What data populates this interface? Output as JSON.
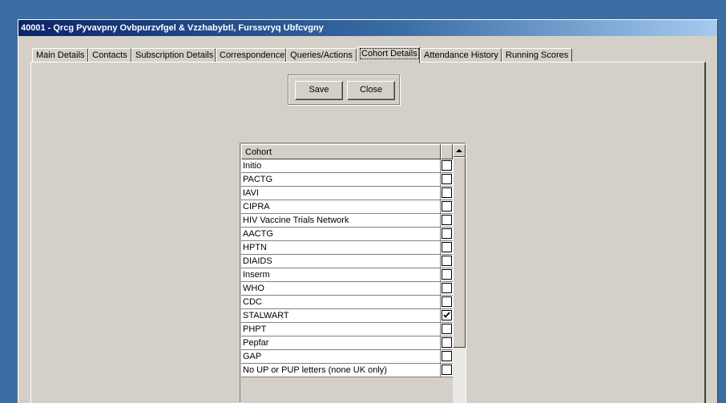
{
  "window": {
    "title": "40001 - Qrcg Pyvavpny Ovbpurzvfgel & Vzzhabybtl, Furssvryq Ubfcvgny"
  },
  "tabs": [
    {
      "label": "Main Details",
      "active": false
    },
    {
      "label": "Contacts",
      "active": false
    },
    {
      "label": "Subscription Details",
      "active": false
    },
    {
      "label": "Correspondence",
      "active": false
    },
    {
      "label": "Queries/Actions",
      "active": false
    },
    {
      "label": "Cohort Details",
      "active": true
    },
    {
      "label": "Attendance History",
      "active": false
    },
    {
      "label": "Running Scores",
      "active": false
    }
  ],
  "buttons": {
    "save": "Save",
    "close": "Close"
  },
  "grid": {
    "header": "Cohort",
    "rows": [
      {
        "name": "Initio",
        "checked": false
      },
      {
        "name": "PACTG",
        "checked": false
      },
      {
        "name": "IAVI",
        "checked": false
      },
      {
        "name": "CIPRA",
        "checked": false
      },
      {
        "name": "HIV Vaccine Trials Network",
        "checked": false
      },
      {
        "name": "AACTG",
        "checked": false
      },
      {
        "name": "HPTN",
        "checked": false
      },
      {
        "name": "DIAIDS",
        "checked": false
      },
      {
        "name": "Inserm",
        "checked": false
      },
      {
        "name": "WHO",
        "checked": false
      },
      {
        "name": "CDC",
        "checked": false
      },
      {
        "name": "STALWART",
        "checked": true
      },
      {
        "name": "PHPT",
        "checked": false
      },
      {
        "name": "Pepfar",
        "checked": false
      },
      {
        "name": "GAP",
        "checked": false
      },
      {
        "name": "No UP or PUP letters (none UK only)",
        "checked": false
      }
    ]
  },
  "colors": {
    "desktop": "#3a6ea5",
    "titlebar_start": "#0a246a",
    "face": "#d4d0c8"
  }
}
